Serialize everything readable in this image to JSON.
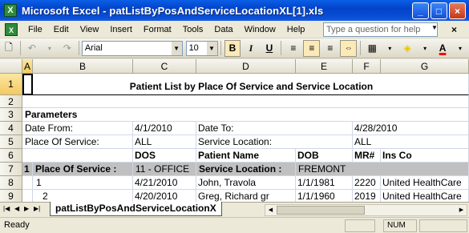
{
  "window": {
    "title": "Microsoft Excel - patListByPosAndServiceLocationXL[1].xls",
    "controls": [
      "_",
      "□",
      "×"
    ]
  },
  "menu": {
    "items": [
      "File",
      "Edit",
      "View",
      "Insert",
      "Format",
      "Tools",
      "Data",
      "Window",
      "Help"
    ],
    "help_placeholder": "Type a question for help"
  },
  "toolbar": {
    "font_name": "Arial",
    "font_size": "10",
    "bold": "B",
    "italic": "I",
    "underline": "U",
    "font_color_label": "A",
    "accent_color": "#ff0000"
  },
  "sheet": {
    "columns": [
      "A",
      "B",
      "C",
      "D",
      "E",
      "F",
      "G"
    ],
    "selected_column": "A",
    "rows": [
      "1",
      "2",
      "3",
      "4",
      "5",
      "6",
      "7",
      "8",
      "9"
    ],
    "selected_row": "1",
    "title": "Patient List by Place Of Service and Service Location",
    "parameters_label": "Parameters",
    "date_from_label": "Date From:",
    "date_from": "4/1/2010",
    "date_to_label": "Date To:",
    "date_to": "4/28/2010",
    "pos_label": "Place Of Service:",
    "pos_value": "ALL",
    "sl_label": "Service Location:",
    "sl_value": "ALL",
    "headers": [
      "DOS",
      "Patient Name",
      "DOB",
      "MR#",
      "Ins Co"
    ],
    "group_number": "1",
    "group_pos_label": "Place Of Service :",
    "group_pos_value": "11 - OFFICE",
    "group_sl_label": "Service Location :",
    "group_sl_value": "FREMONT",
    "data_rows": [
      {
        "num": "1",
        "dos": "4/21/2010",
        "name": "John, Travola",
        "dob": "1/1/1981",
        "mr": "2220",
        "ins": "United HealthCare"
      },
      {
        "num": "2",
        "dos": "4/20/2010",
        "name": "Greg, Richard gr",
        "dob": "1/1/1960",
        "mr": "2019",
        "ins": "United HealthCare"
      }
    ]
  },
  "tabs": {
    "active": "patListByPosAndServiceLocationX"
  },
  "status": {
    "text": "Ready",
    "num": "NUM"
  }
}
